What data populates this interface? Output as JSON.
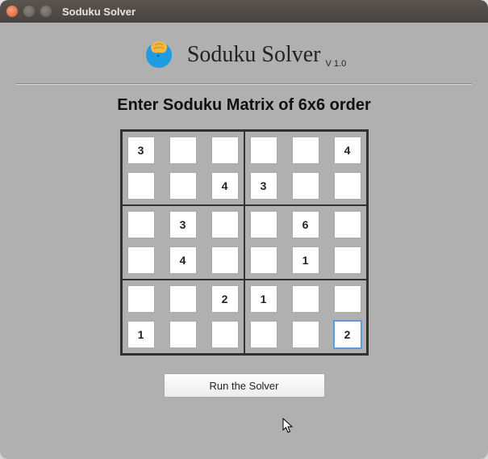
{
  "window": {
    "title": "Soduku Solver"
  },
  "header": {
    "app_title": "Soduku Solver",
    "version": "V 1.0"
  },
  "instruction": "Enter Soduku Matrix of 6x6 order",
  "grid": {
    "rows": 6,
    "cols": 6,
    "box_rows": 2,
    "box_cols": 3,
    "cells": [
      [
        "3",
        "",
        "",
        "",
        "",
        "4"
      ],
      [
        "",
        "",
        "4",
        "3",
        "",
        ""
      ],
      [
        "",
        "3",
        "",
        "",
        "6",
        ""
      ],
      [
        "",
        "4",
        "",
        "",
        "1",
        ""
      ],
      [
        "",
        "",
        "2",
        "1",
        "",
        ""
      ],
      [
        "1",
        "",
        "",
        "",
        "",
        "2"
      ]
    ],
    "focused": [
      5,
      5
    ]
  },
  "actions": {
    "run_label": "Run the Solver"
  },
  "icons": {
    "brain": "brain-icon"
  }
}
